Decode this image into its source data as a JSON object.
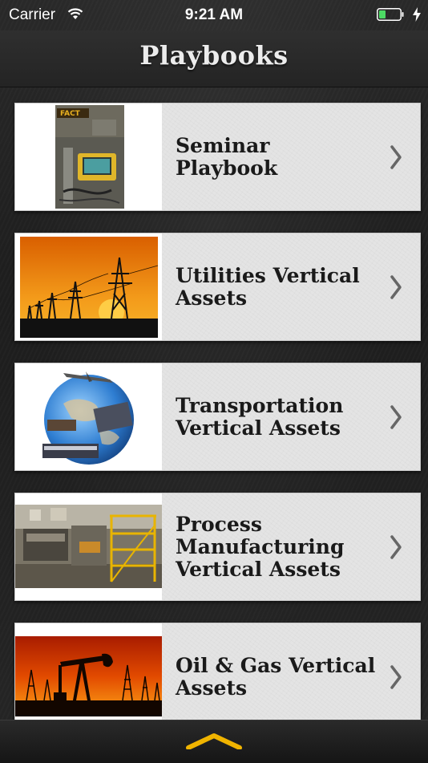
{
  "status_bar": {
    "carrier": "Carrier",
    "time": "9:21 AM",
    "icons": [
      "wifi-icon",
      "battery-icon",
      "charging-bolt-icon"
    ]
  },
  "nav": {
    "title": "Playbooks"
  },
  "playbooks": [
    {
      "label_line1": "Seminar",
      "label_line2": "Playbook",
      "label_line3": "",
      "thumb": "seminar-photo"
    },
    {
      "label_line1": "Utilities Vertical",
      "label_line2": "Assets",
      "label_line3": "",
      "thumb": "power-lines-sunset"
    },
    {
      "label_line1": "Transportation",
      "label_line2": "Vertical Assets",
      "label_line3": "",
      "thumb": "globe-transport"
    },
    {
      "label_line1": "Process",
      "label_line2": "Manufacturing",
      "label_line3": "Vertical Assets",
      "thumb": "factory-floor"
    },
    {
      "label_line1": "Oil & Gas Vertical",
      "label_line2": "Assets",
      "label_line3": "",
      "thumb": "oil-pump-sunset"
    }
  ],
  "bottom_bar": {
    "icon": "chevron-up-icon"
  },
  "colors": {
    "accent": "#f0b400",
    "row_background": "#e4e4e4",
    "label_text": "#1a1a1a"
  }
}
